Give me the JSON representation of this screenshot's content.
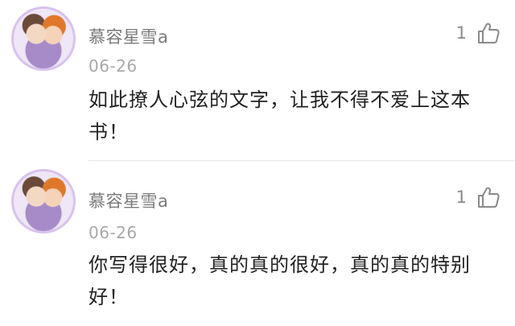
{
  "comments": [
    {
      "username": "慕容星雪a",
      "date": "06-26",
      "text": "如此撩人心弦的文字，让我不得不爱上这本书！",
      "likes": "1",
      "avatar_icon": "anime-avatar",
      "like_icon": "thumbs-up-icon"
    },
    {
      "username": "慕容星雪a",
      "date": "06-26",
      "text": "你写得很好，真的真的很好，真的真的特别好！",
      "likes": "1",
      "avatar_icon": "anime-avatar",
      "like_icon": "thumbs-up-icon"
    }
  ],
  "colors": {
    "username": "#7a7a7a",
    "date": "#a8a8a8",
    "body": "#222222",
    "divider": "#e6e6e6",
    "avatar_border": "#d8c2ee"
  }
}
